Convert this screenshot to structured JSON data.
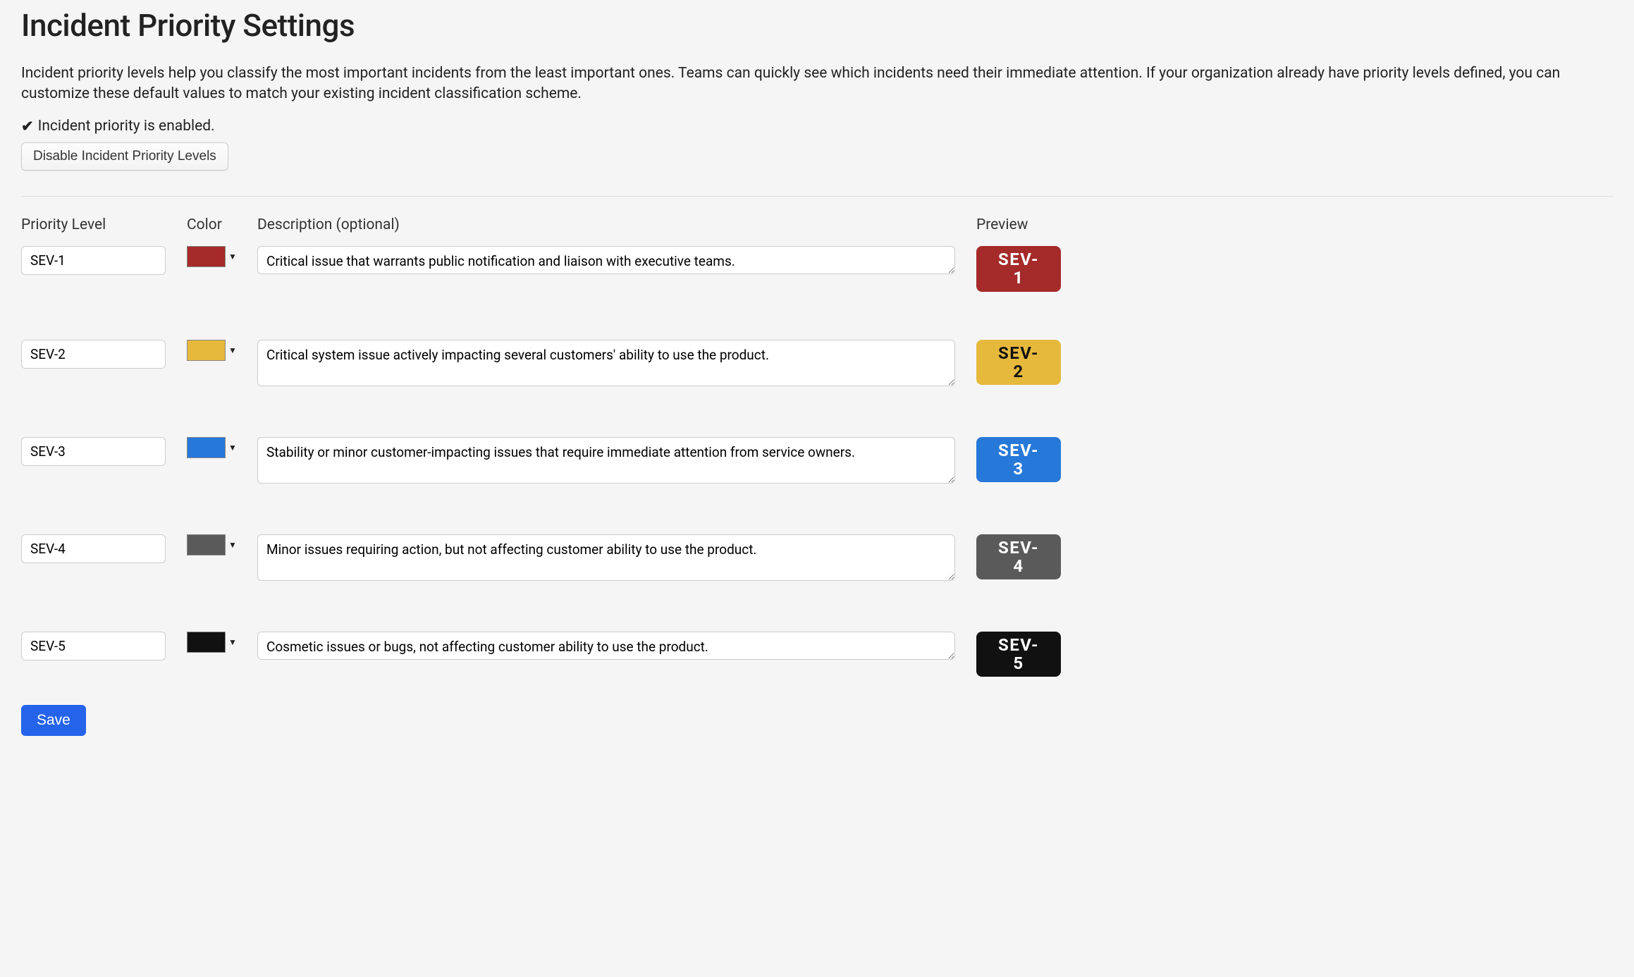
{
  "page": {
    "title": "Incident Priority Settings",
    "intro": "Incident priority levels help you classify the most important incidents from the least important ones. Teams can quickly see which incidents need their immediate attention. If your organization already have priority levels defined, you can customize these default values to match your existing incident classification scheme.",
    "enabled_label": "Incident priority is enabled.",
    "disable_button": "Disable Incident Priority Levels",
    "save_button": "Save"
  },
  "headers": {
    "level": "Priority Level",
    "color": "Color",
    "description": "Description (optional)",
    "preview": "Preview"
  },
  "rows": [
    {
      "name": "SEV-1",
      "color": "#a52a2a",
      "description": "Critical issue that warrants public notification and liaison with executive teams.",
      "preview_text_color": "#ffffff",
      "textarea_rows": 1
    },
    {
      "name": "SEV-2",
      "color": "#e6b93d",
      "description": "Critical system issue actively impacting several customers' ability to use the product.",
      "preview_text_color": "#111111",
      "textarea_rows": 2
    },
    {
      "name": "SEV-3",
      "color": "#2678d9",
      "description": "Stability or minor customer-impacting issues that require immediate attention from service owners.",
      "preview_text_color": "#ffffff",
      "textarea_rows": 2
    },
    {
      "name": "SEV-4",
      "color": "#5a5a5a",
      "description": "Minor issues requiring action, but not affecting customer ability to use the product.",
      "preview_text_color": "#ffffff",
      "textarea_rows": 2
    },
    {
      "name": "SEV-5",
      "color": "#111111",
      "description": "Cosmetic issues or bugs, not affecting customer ability to use the product.",
      "preview_text_color": "#ffffff",
      "textarea_rows": 1
    }
  ]
}
